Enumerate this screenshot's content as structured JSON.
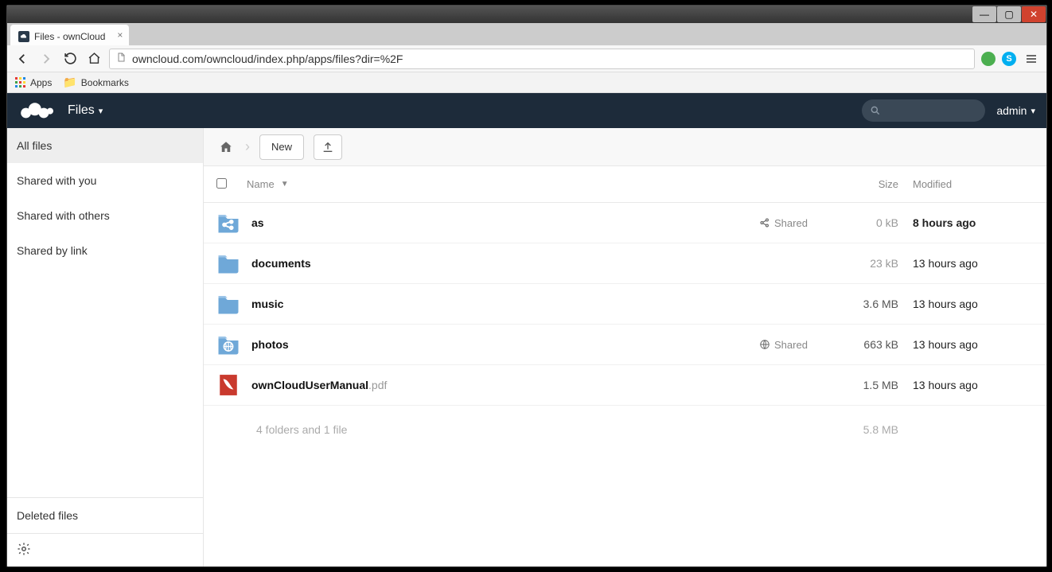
{
  "os": {
    "min": "—",
    "max": "▢",
    "close": "✕"
  },
  "browser": {
    "tab_title": "Files - ownCloud",
    "tab_close": "×",
    "url": "owncloud.com/owncloud/index.php/apps/files?dir=%2F",
    "apps_label": "Apps",
    "bookmarks_label": "Bookmarks",
    "skype_letter": "S"
  },
  "oc": {
    "app_name": "Files",
    "dropdown_glyph": "▾",
    "user": "admin",
    "sidebar": {
      "all_files": "All files",
      "shared_with_you": "Shared with you",
      "shared_with_others": "Shared with others",
      "shared_by_link": "Shared by link",
      "deleted": "Deleted files"
    },
    "crumb": {
      "new_label": "New"
    },
    "columns": {
      "name": "Name",
      "sort_glyph": "▼",
      "size": "Size",
      "modified": "Modified"
    },
    "shared_label": "Shared",
    "rows": [
      {
        "name": "as",
        "ext": "",
        "icon": "share-folder",
        "shared": "share",
        "size": "0 kB",
        "size_dark": false,
        "modified": "8 hours ago",
        "mod_bold": true
      },
      {
        "name": "documents",
        "ext": "",
        "icon": "folder",
        "shared": "",
        "size": "23 kB",
        "size_dark": false,
        "modified": "13 hours ago",
        "mod_bold": false
      },
      {
        "name": "music",
        "ext": "",
        "icon": "folder",
        "shared": "",
        "size": "3.6 MB",
        "size_dark": true,
        "modified": "13 hours ago",
        "mod_bold": false
      },
      {
        "name": "photos",
        "ext": "",
        "icon": "public-folder",
        "shared": "public",
        "size": "663 kB",
        "size_dark": true,
        "modified": "13 hours ago",
        "mod_bold": false
      },
      {
        "name": "ownCloudUserManual",
        "ext": ".pdf",
        "icon": "pdf",
        "shared": "",
        "size": "1.5 MB",
        "size_dark": true,
        "modified": "13 hours ago",
        "mod_bold": false
      }
    ],
    "summary": {
      "text": "4 folders and 1 file",
      "size": "5.8 MB"
    }
  }
}
